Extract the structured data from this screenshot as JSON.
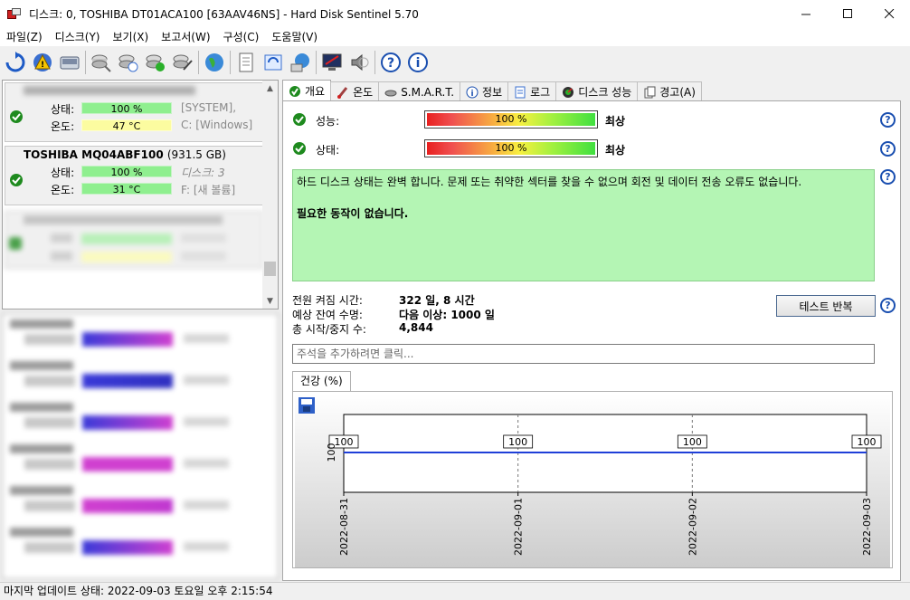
{
  "window": {
    "title": "디스크: 0, TOSHIBA DT01ACA100 [63AAV46NS]  -  Hard Disk Sentinel 5.70"
  },
  "menu": [
    {
      "label": "파일(Z)",
      "name": "menu-file"
    },
    {
      "label": "디스크(Y)",
      "name": "menu-disk"
    },
    {
      "label": "보기(X)",
      "name": "menu-view"
    },
    {
      "label": "보고서(W)",
      "name": "menu-report"
    },
    {
      "label": "구성(C)",
      "name": "menu-config"
    },
    {
      "label": "도움말(V)",
      "name": "menu-help"
    }
  ],
  "disks": [
    {
      "name": "",
      "status_label": "상태:",
      "status_value": "100 %",
      "status_info": "[SYSTEM],",
      "temp_label": "온도:",
      "temp_value": "47 °C",
      "temp_info": "C: [Windows]"
    },
    {
      "name": "TOSHIBA MQ04ABF100",
      "size": "(931.5 GB)",
      "status_label": "상태:",
      "status_value": "100 %",
      "status_info": "디스크: 3",
      "temp_label": "온도:",
      "temp_value": "31 °C",
      "temp_info": "F: [새 볼륨]"
    }
  ],
  "status_bar": {
    "text": "마지막 업데이트 상태: 2022-09-03 토요일 오후 2:15:54"
  },
  "tabs": [
    {
      "label": "개요",
      "name": "tab-overview",
      "icon": "check-icon"
    },
    {
      "label": "온도",
      "name": "tab-temperature",
      "icon": "thermometer-icon"
    },
    {
      "label": "S.M.A.R.T.",
      "name": "tab-smart",
      "icon": "smart-icon"
    },
    {
      "label": "정보",
      "name": "tab-info",
      "icon": "info-icon"
    },
    {
      "label": "로그",
      "name": "tab-log",
      "icon": "log-icon"
    },
    {
      "label": "디스크 성능",
      "name": "tab-performance",
      "icon": "gauge-icon"
    },
    {
      "label": "경고(A)",
      "name": "tab-alerts",
      "icon": "alert-icon"
    }
  ],
  "overview": {
    "performance_label": "성능:",
    "performance_value": "100 %",
    "performance_rating": "최상",
    "health_label": "상태:",
    "health_value": "100 %",
    "health_rating": "최상",
    "status_text": "하드 디스크 상태는 완벽 합니다. 문제 또는 취약한 섹터를 찾을 수 없으며 회전 및 데이터 전송 오류도 없습니다.",
    "action_text": "필요한 동작이 없습니다.",
    "stats": [
      {
        "label": "전원 켜짐 시간:",
        "value": "322 일, 8 시간"
      },
      {
        "label": "예상 잔여 수명:",
        "value": "다음 이상: 1000 일"
      },
      {
        "label": "총 시작/중지 수:",
        "value": "4,844"
      }
    ],
    "test_button": "테스트 반복",
    "comment_placeholder": "주석을 추가하려면 클릭...",
    "chart_tab": "건강 (%)"
  },
  "chart_data": {
    "type": "line",
    "title": "",
    "xlabel": "",
    "ylabel": "",
    "x": [
      "2022-08-31",
      "2022-09-01",
      "2022-09-02",
      "2022-09-03"
    ],
    "series": [
      {
        "values": [
          100,
          100,
          100,
          100
        ]
      }
    ],
    "y_tick": "100",
    "ylim": [
      0,
      100
    ],
    "grid": true,
    "color": "#1f3fd8"
  },
  "colors": {
    "bar_green": "#8fef8f",
    "bar_yellow": "#fcfca0",
    "status_bg": "#b4f5b4",
    "help_blue": "#1a4fb0"
  }
}
